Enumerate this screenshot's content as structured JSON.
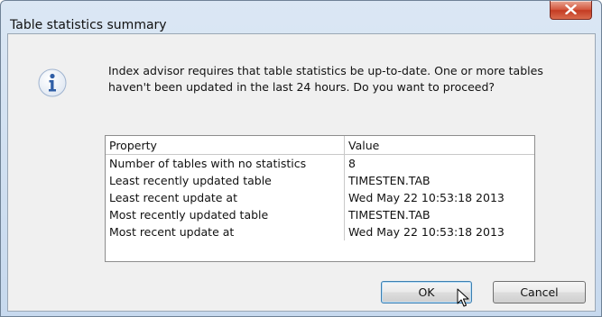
{
  "dialog": {
    "title": "Table statistics summary",
    "message_line1": "Index advisor requires that table statistics be up-to-date. One or more tables",
    "message_line2": "haven't been updated in the last 24 hours. Do you want to proceed?"
  },
  "table": {
    "headers": [
      "Property",
      "Value"
    ],
    "rows": [
      [
        "Number of tables with no statistics",
        "8"
      ],
      [
        "Least recently updated table",
        "TIMESTEN.TAB"
      ],
      [
        "Least recent update at",
        "Wed May 22 10:53:18 2013"
      ],
      [
        "Most recently updated table",
        "TIMESTEN.TAB"
      ],
      [
        "Most recent update at",
        "Wed May 22 10:53:18 2013"
      ]
    ]
  },
  "buttons": {
    "ok": "OK",
    "cancel": "Cancel"
  },
  "icons": {
    "info": "info-icon",
    "close": "close-icon",
    "cursor": "mouse-pointer"
  },
  "colors": {
    "info_blue": "#2f5ea6",
    "close_red": "#c43b22"
  }
}
